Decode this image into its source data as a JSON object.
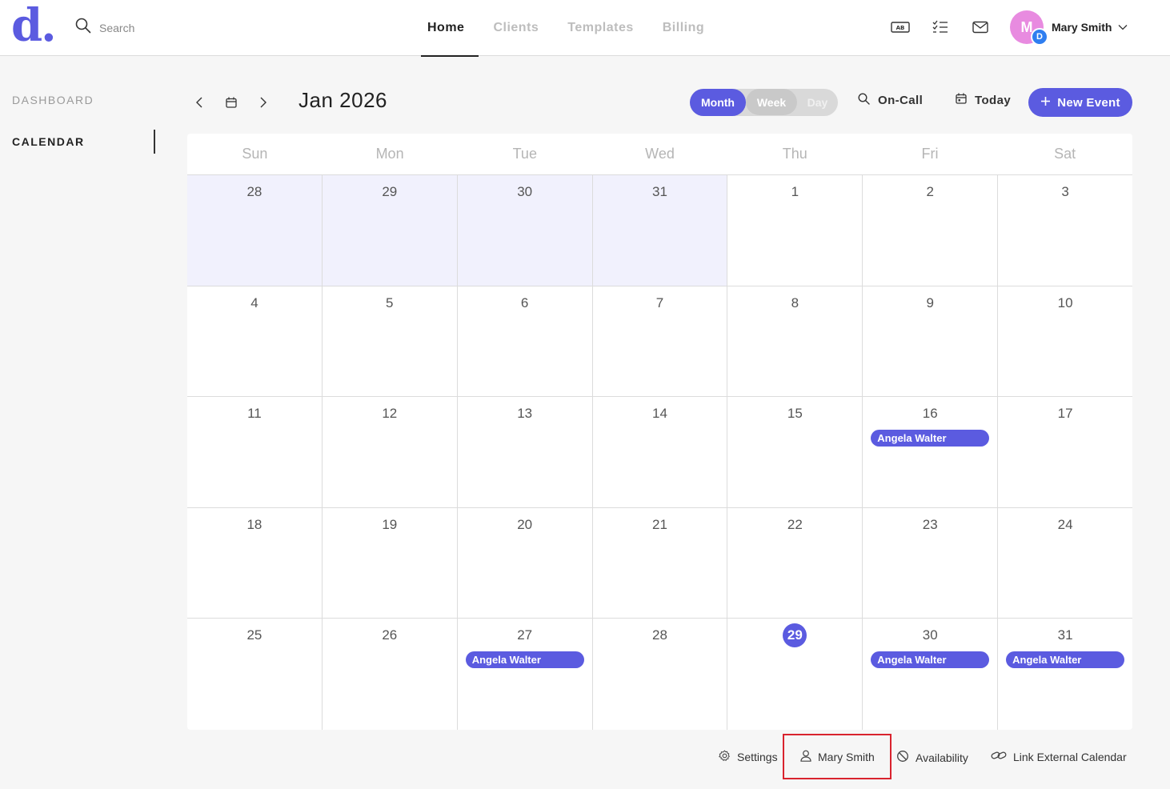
{
  "header": {
    "logo": "d.",
    "search_placeholder": "Search",
    "nav": [
      "Home",
      "Clients",
      "Templates",
      "Billing"
    ],
    "active_nav": "Home",
    "user": {
      "name": "Mary Smith",
      "avatar_initial": "M",
      "badge": "D"
    },
    "icons": [
      "ab-icon",
      "checklist-icon",
      "mail-icon"
    ]
  },
  "sidebar": {
    "items": [
      "DASHBOARD",
      "CALENDAR"
    ],
    "active": "CALENDAR"
  },
  "calendar": {
    "title": "Jan 2026",
    "views": [
      "Month",
      "Week",
      "Day"
    ],
    "active_view": "Month",
    "on_call_label": "On-Call",
    "today_label": "Today",
    "new_event_label": "New Event",
    "weekdays": [
      "Sun",
      "Mon",
      "Tue",
      "Wed",
      "Thu",
      "Fri",
      "Sat"
    ],
    "weeks": [
      [
        {
          "d": "28",
          "prev": true
        },
        {
          "d": "29",
          "prev": true
        },
        {
          "d": "30",
          "prev": true
        },
        {
          "d": "31",
          "prev": true
        },
        {
          "d": "1"
        },
        {
          "d": "2"
        },
        {
          "d": "3"
        }
      ],
      [
        {
          "d": "4"
        },
        {
          "d": "5"
        },
        {
          "d": "6"
        },
        {
          "d": "7"
        },
        {
          "d": "8"
        },
        {
          "d": "9"
        },
        {
          "d": "10"
        }
      ],
      [
        {
          "d": "11"
        },
        {
          "d": "12"
        },
        {
          "d": "13"
        },
        {
          "d": "14"
        },
        {
          "d": "15"
        },
        {
          "d": "16",
          "event": "Angela Walter"
        },
        {
          "d": "17"
        }
      ],
      [
        {
          "d": "18"
        },
        {
          "d": "19"
        },
        {
          "d": "20"
        },
        {
          "d": "21"
        },
        {
          "d": "22"
        },
        {
          "d": "23"
        },
        {
          "d": "24"
        }
      ],
      [
        {
          "d": "25"
        },
        {
          "d": "26"
        },
        {
          "d": "27",
          "event": "Angela Walter"
        },
        {
          "d": "28"
        },
        {
          "d": "29",
          "today": true
        },
        {
          "d": "30",
          "event": "Angela Walter"
        },
        {
          "d": "31",
          "event": "Angela Walter"
        }
      ]
    ],
    "accent": "#5b5be0"
  },
  "footer": {
    "links": [
      "Settings",
      "Mary Smith",
      "Availability",
      "Link External Calendar"
    ],
    "highlighted": "Mary Smith"
  }
}
